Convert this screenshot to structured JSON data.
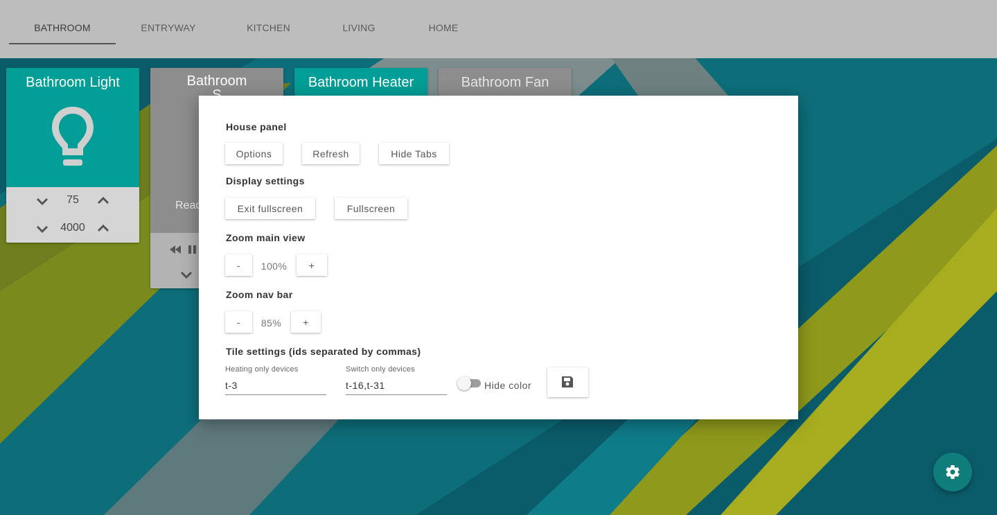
{
  "colors": {
    "accent": "#009e96",
    "nav_background": "#bdbdbd",
    "tile_inactive": "#8d8d8d",
    "fab": "#0f7d7a"
  },
  "nav": {
    "tabs": [
      {
        "label": "BATHROOM",
        "active": true
      },
      {
        "label": "ENTRYWAY",
        "active": false
      },
      {
        "label": "KITCHEN",
        "active": false
      },
      {
        "label": "LIVING",
        "active": false
      },
      {
        "label": "HOME",
        "active": false
      }
    ]
  },
  "tiles": {
    "light": {
      "title": "Bathroom Light",
      "icon": "lightbulb-icon",
      "level": "75",
      "color_temp": "4000"
    },
    "speaker": {
      "title_line1": "Bathroom",
      "title_line2": "S",
      "status_fragment": "Read",
      "icons": [
        "rewind-icon",
        "pause-icon",
        "chevron-down-icon"
      ]
    },
    "heater": {
      "title": "Bathroom Heater"
    },
    "fan": {
      "title": "Bathroom Fan"
    }
  },
  "modal": {
    "house_panel": {
      "title": "House panel",
      "options_label": "Options",
      "refresh_label": "Refresh",
      "hide_tabs_label": "Hide Tabs"
    },
    "display_settings": {
      "title": "Display settings",
      "exit_fullscreen_label": "Exit fullscreen",
      "fullscreen_label": "Fullscreen"
    },
    "zoom_main": {
      "title": "Zoom main view",
      "minus_label": "-",
      "value": "100%",
      "plus_label": "+"
    },
    "zoom_nav": {
      "title": "Zoom nav bar",
      "minus_label": "-",
      "value": "85%",
      "plus_label": "+"
    },
    "tile_settings": {
      "title": "Tile settings (ids separated by commas)",
      "heating_label": "Heating only devices",
      "heating_value": "t-3",
      "switch_label": "Switch only devices",
      "switch_value": "t-16,t-31",
      "hide_color_label": "Hide color",
      "hide_color_on": false,
      "save_icon": "save-icon"
    }
  },
  "fab": {
    "icon": "gear-icon"
  }
}
